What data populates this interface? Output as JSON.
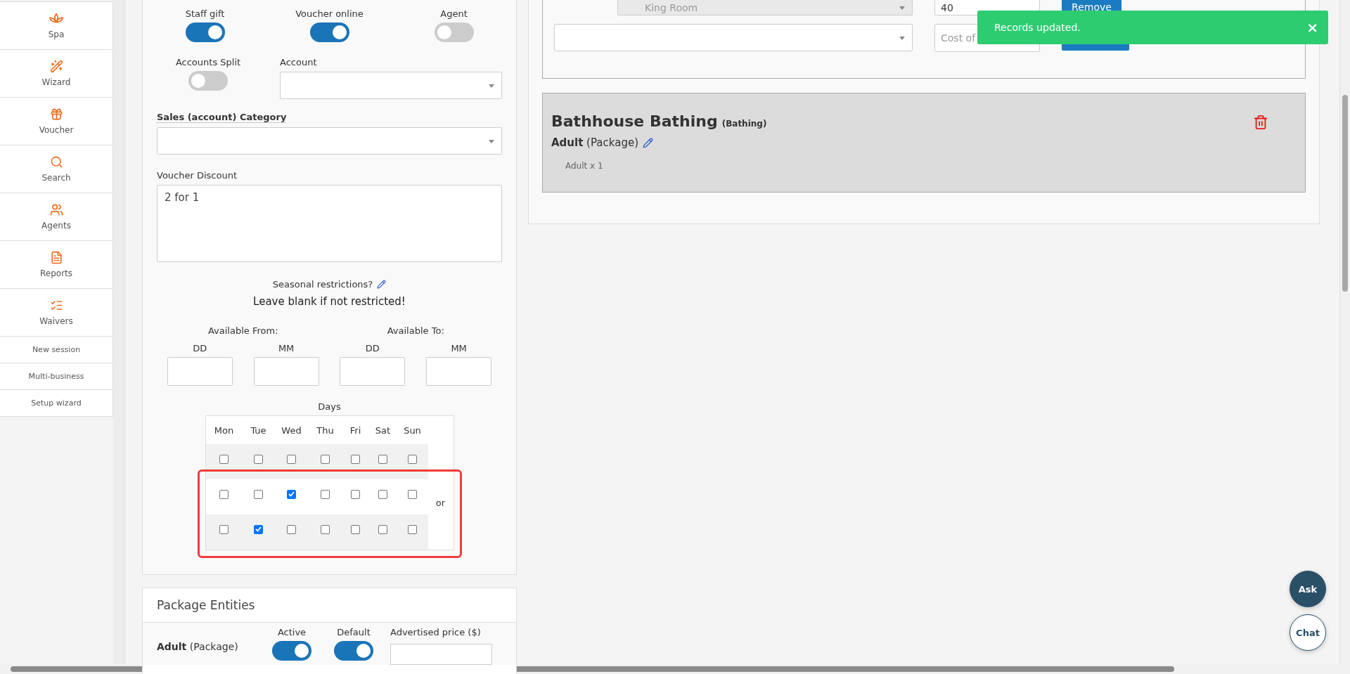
{
  "sidebar": {
    "items": [
      {
        "label": "Spa"
      },
      {
        "label": "Wizard"
      },
      {
        "label": "Voucher"
      },
      {
        "label": "Search"
      },
      {
        "label": "Agents"
      },
      {
        "label": "Reports"
      },
      {
        "label": "Waivers"
      }
    ],
    "links": [
      "New session",
      "Multi-business",
      "Setup wizard"
    ]
  },
  "voucher_form": {
    "toggles": [
      {
        "label": "Staff gift",
        "on": true
      },
      {
        "label": "Voucher online",
        "on": true
      },
      {
        "label": "Agent",
        "on": false
      }
    ],
    "accounts_split": {
      "label": "Accounts Split",
      "on": false
    },
    "account": {
      "label": "Account"
    },
    "sales_category": {
      "label": "Sales (account) Category"
    },
    "voucher_discount": {
      "label": "Voucher Discount",
      "value": "2 for 1"
    },
    "seasonal": {
      "title": "Seasonal restrictions?",
      "note": "Leave blank if not restricted!"
    },
    "available": [
      {
        "label": "Available From:",
        "fields": [
          "DD",
          "MM"
        ]
      },
      {
        "label": "Available To:",
        "fields": [
          "DD",
          "MM"
        ]
      }
    ],
    "days": {
      "label": "Days",
      "columns": [
        "Mon",
        "Tue",
        "Wed",
        "Thu",
        "Fri",
        "Sat",
        "Sun"
      ],
      "rows": [
        {
          "highlighted": false,
          "checks": [
            {
              "checked": false
            },
            {
              "checked": false
            },
            {
              "checked": false
            },
            {
              "checked": false
            },
            {
              "checked": false
            },
            {
              "checked": false
            },
            {
              "checked": false
            }
          ]
        },
        {
          "highlighted": true,
          "suffix": "or",
          "checks": [
            {
              "checked": false
            },
            {
              "checked": false
            },
            {
              "checked": true
            },
            {
              "checked": false
            },
            {
              "checked": false
            },
            {
              "checked": false
            },
            {
              "checked": false
            }
          ]
        },
        {
          "highlighted": true,
          "checks": [
            {
              "checked": false
            },
            {
              "checked": true
            },
            {
              "checked": false
            },
            {
              "checked": false
            },
            {
              "checked": false
            },
            {
              "checked": false
            },
            {
              "checked": false
            }
          ]
        }
      ]
    }
  },
  "package_entities": {
    "title": "Package Entities",
    "entity": "**Adult** (Package)",
    "toggles": [
      {
        "label": "Active",
        "on": true
      },
      {
        "label": "Default",
        "on": true
      }
    ],
    "price_label": "Advertised price ($)"
  },
  "room_swaps": {
    "rows": [
      {
        "room": "King Room",
        "disabled": true,
        "value": "40",
        "action": "Remove"
      }
    ],
    "new_row": {
      "placeholder": "Cost of"
    }
  },
  "package_card": {
    "title": "Bathhouse Bathing",
    "category": "(Bathing)",
    "entity": "**Adult** (Package)",
    "line": "Adult x 1"
  },
  "toast": {
    "message": "Records updated.",
    "close": "×"
  },
  "help_buttons": [
    "Ask",
    "Chat"
  ]
}
